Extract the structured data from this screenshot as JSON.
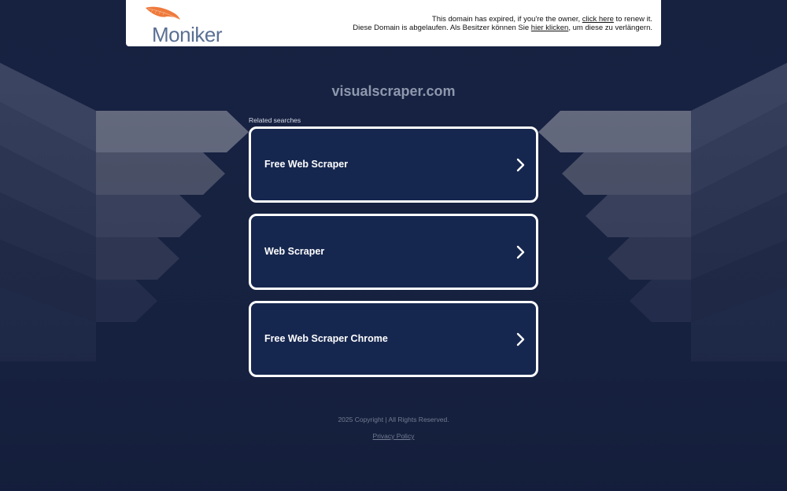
{
  "header": {
    "logo_text": "Moniker",
    "expiry_line1_before": "This domain has expired, if you're the owner, ",
    "expiry_line1_link": "click here",
    "expiry_line1_after": " to renew it.",
    "expiry_line2_before": "Diese Domain is abgelaufen. Als Besitzer können Sie ",
    "expiry_line2_link": "hier klicken",
    "expiry_line2_after": ", um diese zu verlängern."
  },
  "main": {
    "domain": "visualscraper.com",
    "related_label": "Related searches",
    "searches": [
      {
        "label": "Free Web Scraper"
      },
      {
        "label": "Web Scraper"
      },
      {
        "label": "Free Web Scraper Chrome"
      }
    ]
  },
  "footer": {
    "copyright": "2025 Copyright | All Rights Reserved.",
    "privacy": "Privacy Policy"
  },
  "colors": {
    "background": "#172241",
    "button_fill": "#16274f",
    "button_border": "#ffffff",
    "logo_text": "#5a6f94",
    "logo_feather": "#ee7a3c"
  },
  "icons": {
    "logo": "feather-quill-icon",
    "button_arrow": "chevron-right-icon"
  }
}
